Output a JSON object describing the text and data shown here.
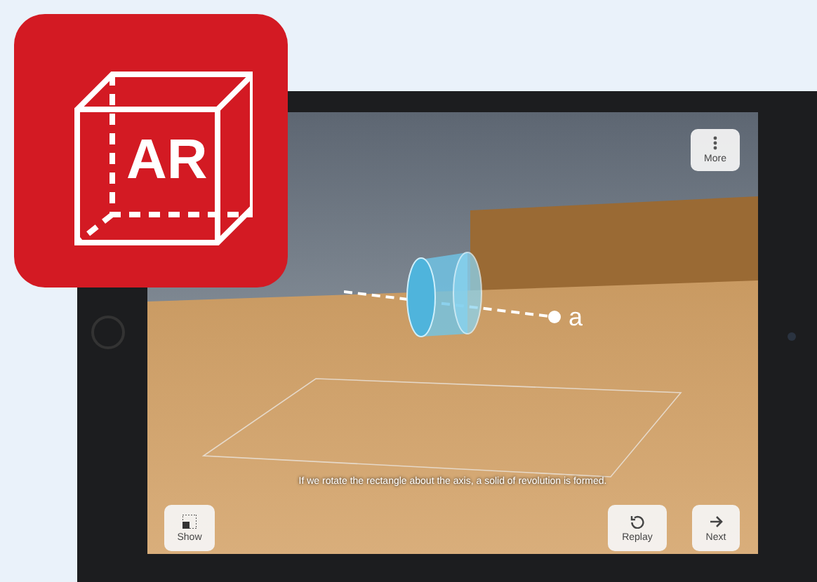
{
  "badge": {
    "label": "AR"
  },
  "ar_view": {
    "axis_label": "a",
    "caption": "If we rotate the rectangle about the axis, a solid of revolution is formed."
  },
  "buttons": [
    {
      "kind": "more",
      "label": "More"
    },
    {
      "kind": "show",
      "label": "Show"
    },
    {
      "kind": "replay",
      "label": "Replay"
    },
    {
      "kind": "next",
      "label": "Next"
    }
  ]
}
